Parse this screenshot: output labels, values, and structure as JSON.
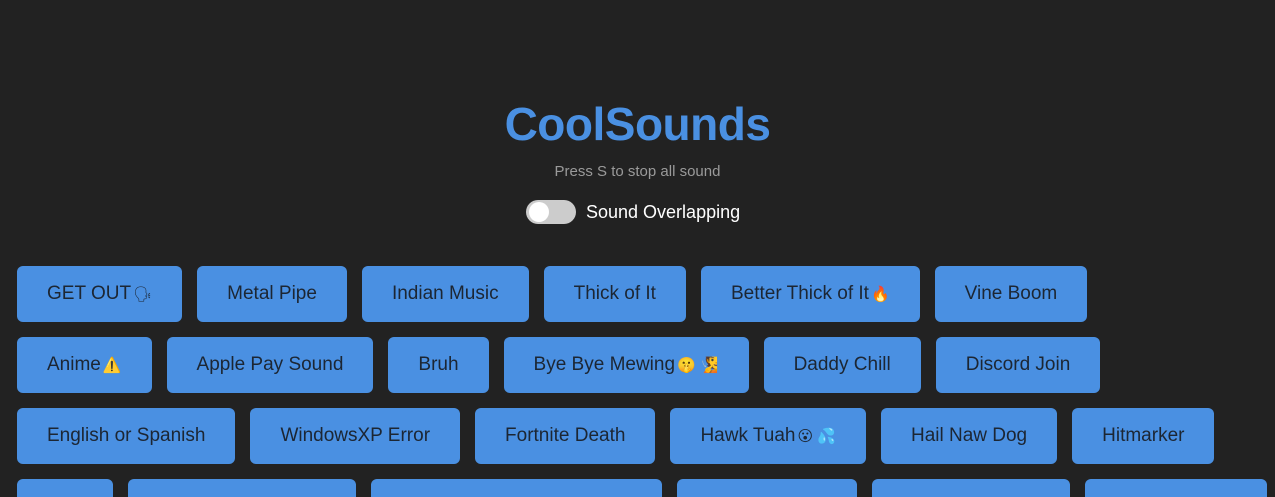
{
  "header": {
    "title": "CoolSounds",
    "subtitle": "Press S to stop all sound"
  },
  "toggle": {
    "label": "Sound Overlapping",
    "checked": false
  },
  "sounds": [
    [
      {
        "label": "GET OUT",
        "emoji": "🗣"
      },
      {
        "label": "Metal Pipe",
        "emoji": ""
      },
      {
        "label": "Indian Music",
        "emoji": ""
      },
      {
        "label": "Thick of It",
        "emoji": ""
      },
      {
        "label": "Better Thick of It",
        "emoji": "🔥"
      },
      {
        "label": "Vine Boom",
        "emoji": ""
      }
    ],
    [
      {
        "label": "Anime",
        "emoji": "⚠️"
      },
      {
        "label": "Apple Pay Sound",
        "emoji": ""
      },
      {
        "label": "Bruh",
        "emoji": ""
      },
      {
        "label": "Bye Bye Mewing",
        "emoji": "🤫 🧏"
      },
      {
        "label": "Daddy Chill",
        "emoji": ""
      },
      {
        "label": "Discord Join",
        "emoji": ""
      }
    ],
    [
      {
        "label": "English or Spanish",
        "emoji": ""
      },
      {
        "label": "WindowsXP Error",
        "emoji": ""
      },
      {
        "label": "Fortnite Death",
        "emoji": ""
      },
      {
        "label": "Hawk Tuah",
        "emoji": "😮 💦"
      },
      {
        "label": "Hail Naw Dog",
        "emoji": ""
      },
      {
        "label": "Hitmarker",
        "emoji": ""
      }
    ]
  ],
  "colors": {
    "background": "#222222",
    "accent": "#4a90e2",
    "button_text": "#1c2633",
    "subtitle": "#9a9a9a",
    "toggle_track": "#cccccc"
  }
}
